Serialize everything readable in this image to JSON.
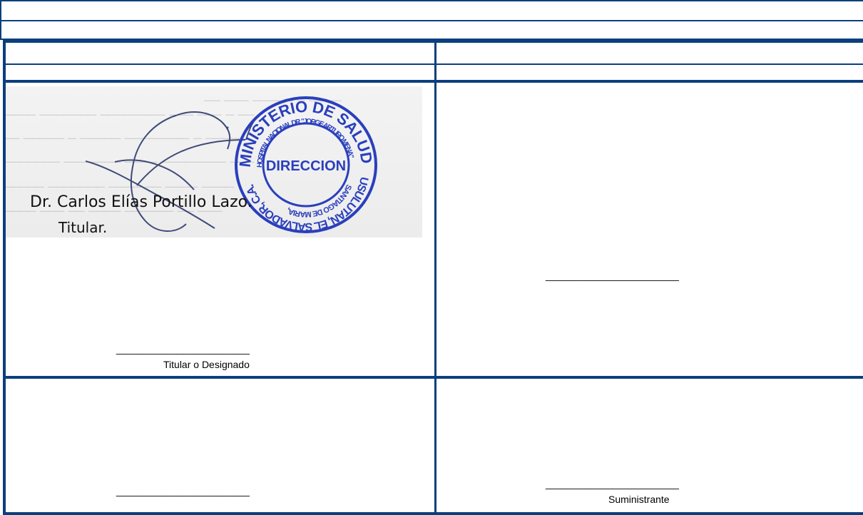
{
  "signature": {
    "name": "Dr. Carlos Elías Portillo Lazo.",
    "title": "Titular."
  },
  "stamp": {
    "outer_text": "MINISTERIO DE SALUD",
    "inner_text_top": "HOSPITAL NACIONAL DR. \"JORGE ARTURO MENA\"",
    "center_text": "DIRECCION",
    "inner_text_bottom": "SANTIAGO DE MARIA,",
    "outer_bottom": "USULUTAN, EL SALVADOR, C.A."
  },
  "cells": {
    "top_left": {
      "signature_line": "________________________",
      "label": "Titular o Designado"
    },
    "top_right": {
      "signature_line": "________________________",
      "label": ""
    },
    "bottom_left": {
      "signature_line": "________________________",
      "label": ""
    },
    "bottom_right": {
      "signature_line": "________________________",
      "label": "Suministrante"
    }
  },
  "colors": {
    "border": "#0b3f7d",
    "stamp": "#2a3fbd"
  }
}
